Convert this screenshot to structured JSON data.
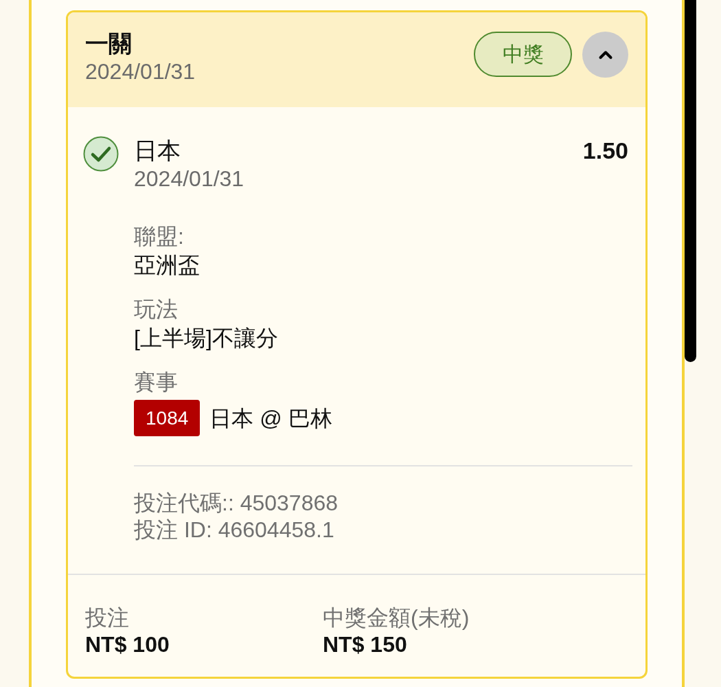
{
  "bet_card": {
    "header": {
      "title": "一關",
      "date": "2024/01/31",
      "status_badge": "中獎",
      "expanded": true
    },
    "selection": {
      "won": true,
      "team": "日本",
      "date": "2024/01/31",
      "odds": "1.50"
    },
    "details": [
      {
        "kind": "text",
        "label": "聯盟:",
        "value": "亞洲盃"
      },
      {
        "kind": "text",
        "label": "玩法",
        "value": "[上半場]不讓分"
      },
      {
        "kind": "match",
        "label": "賽事",
        "match_code": "1084",
        "value": "日本 @ 巴林"
      }
    ],
    "references": [
      "投注代碼:: 45037868",
      "投注 ID: 46604458.1"
    ],
    "summary": [
      {
        "label": "投注",
        "amount": "NT$ 100"
      },
      {
        "label": "中獎金額(未稅)",
        "amount": "NT$ 150"
      }
    ]
  }
}
